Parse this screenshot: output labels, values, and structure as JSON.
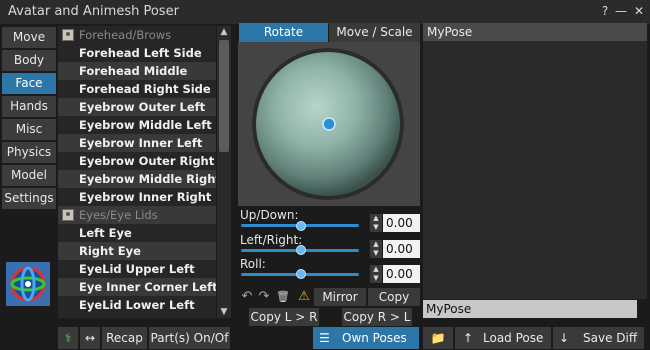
{
  "window": {
    "title": "Avatar and Animesh Poser",
    "controls": [
      "?",
      "—",
      "✕"
    ]
  },
  "side_tabs": [
    "Move",
    "Body",
    "Face",
    "Hands",
    "Misc",
    "Physics",
    "Model",
    "Settings"
  ],
  "active_side_tab": "Face",
  "joints": [
    {
      "label": "Forehead/Brows",
      "type": "group"
    },
    {
      "label": "Forehead Left Side",
      "type": "item"
    },
    {
      "label": "Forehead Middle",
      "type": "item"
    },
    {
      "label": "Forehead Right Side",
      "type": "item"
    },
    {
      "label": "Eyebrow Outer Left",
      "type": "item"
    },
    {
      "label": "Eyebrow Middle Left",
      "type": "item"
    },
    {
      "label": "Eyebrow Inner Left",
      "type": "item"
    },
    {
      "label": "Eyebrow Outer Right",
      "type": "item"
    },
    {
      "label": "Eyebrow Middle Right",
      "type": "item"
    },
    {
      "label": "Eyebrow Inner Right",
      "type": "item"
    },
    {
      "label": "Eyes/Eye Lids",
      "type": "group"
    },
    {
      "label": "Left Eye",
      "type": "item"
    },
    {
      "label": "Right Eye",
      "type": "item"
    },
    {
      "label": "EyeLid Upper Left",
      "type": "item"
    },
    {
      "label": "Eye Inner Corner Left",
      "type": "item"
    },
    {
      "label": "EyeLid Lower Left",
      "type": "item"
    }
  ],
  "mode_tabs": {
    "rotate": "Rotate",
    "move_scale": "Move / Scale",
    "active": "rotate"
  },
  "sliders": [
    {
      "label": "Up/Down:",
      "value": "0.00",
      "position": 0.5
    },
    {
      "label": "Left/Right:",
      "value": "0.00",
      "position": 0.5
    },
    {
      "label": "Roll:",
      "value": "0.00",
      "position": 0.5
    }
  ],
  "actions": {
    "undo_icon": "↶",
    "redo_icon": "↷",
    "delete_icon": "🗑",
    "warning_icon": "⚠",
    "mirror": "Mirror",
    "copy": "Copy",
    "copy_l_to_r": "Copy L > R",
    "copy_r_to_l": "Copy R > L"
  },
  "bottom_left": {
    "figure_icon": "⚕",
    "swap_icon": "↔",
    "recap": "Recap",
    "parts_toggle": "Part(s) On/Of"
  },
  "own_poses": "Own Poses",
  "pose_list": {
    "header": "MyPose",
    "items": []
  },
  "pose_name_input": "MyPose",
  "bottom_right": {
    "folder_icon": "📁",
    "load_icon": "↑",
    "load_pose": "Load Pose",
    "save_icon": "↓",
    "save_diff": "Save Diff"
  }
}
